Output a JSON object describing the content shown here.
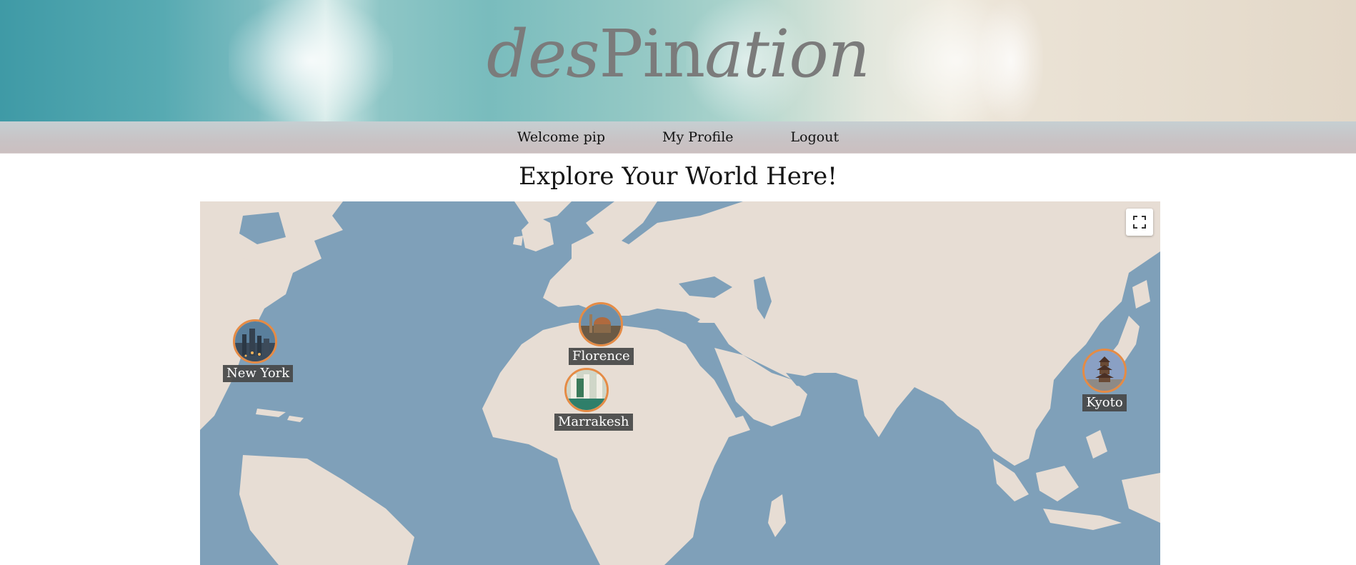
{
  "site": {
    "brand_parts": [
      {
        "text": "des",
        "italic": true
      },
      {
        "text": "Pin",
        "italic": false
      },
      {
        "text": "ation",
        "italic": true
      }
    ]
  },
  "nav": {
    "items": [
      "Welcome pip",
      "My Profile",
      "Logout"
    ]
  },
  "main": {
    "title": "Explore Your World Here!"
  },
  "map": {
    "water_color": "#7fa0b9",
    "land_color": "#e7ddd4",
    "marker_border_color": "#e58b45",
    "controls": {
      "fullscreen_icon": "fullscreen-icon"
    },
    "pins": [
      {
        "name": "New York",
        "lat": 40.71,
        "lon": -74.0
      },
      {
        "name": "Florence",
        "lat": 43.77,
        "lon": 11.26
      },
      {
        "name": "Marrakesh",
        "lat": 31.63,
        "lon": -7.99
      },
      {
        "name": "Kyoto",
        "lat": 35.01,
        "lon": 135.77
      }
    ]
  }
}
